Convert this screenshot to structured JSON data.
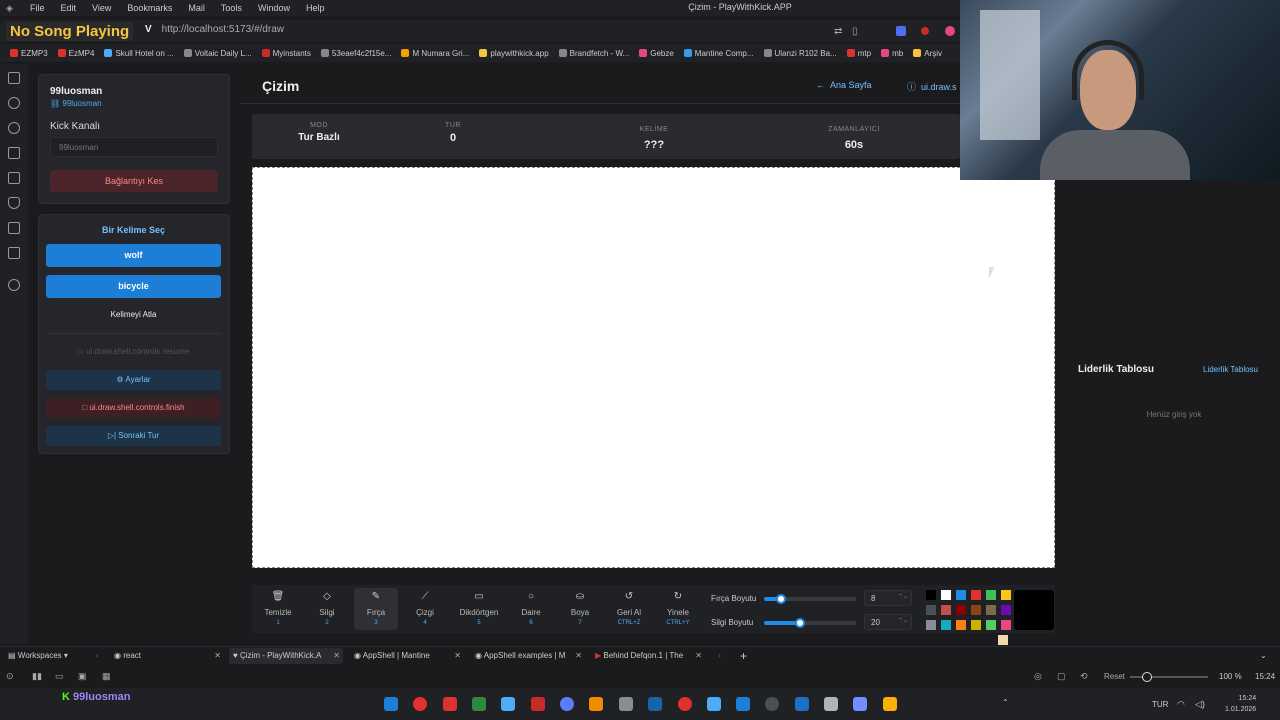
{
  "menu": {
    "items": [
      "File",
      "Edit",
      "View",
      "Bookmarks",
      "Mail",
      "Tools",
      "Window",
      "Help"
    ],
    "window_title": "Çizim - PlayWithKick.APP"
  },
  "overlay": {
    "now_playing": "No Song Playing"
  },
  "browser": {
    "url": "http://localhost:5173/#/draw",
    "url_prefix": "V"
  },
  "bookmarks": [
    {
      "label": "EZMP3",
      "color": "#e03131"
    },
    {
      "label": "EzMP4",
      "color": "#e03131"
    },
    {
      "label": "Skull Hotel on ...",
      "color": "#4dabf7"
    },
    {
      "label": "Voltaic Daily L...",
      "color": "#888888"
    },
    {
      "label": "Myinstants",
      "color": "#c92a2a"
    },
    {
      "label": "53eaef4c2f15e...",
      "color": "#888888"
    },
    {
      "label": "M Numara Gri...",
      "color": "#f59f00"
    },
    {
      "label": "playwithkick.app",
      "color": "#f5c542"
    },
    {
      "label": "Brandfetch - W...",
      "color": "#888888"
    },
    {
      "label": "Gebze",
      "color": "#e64980"
    },
    {
      "label": "Mantine Comp...",
      "color": "#339af0"
    },
    {
      "label": "Ulanzi R102 Ba...",
      "color": "#888888"
    },
    {
      "label": "mtp",
      "color": "#e03131"
    },
    {
      "label": "mb",
      "color": "#e64980"
    },
    {
      "label": "Arşiv",
      "color": "#f5c542"
    }
  ],
  "sidebar": {
    "user_name": "99luosman",
    "user_handle": "99luosman",
    "kick_label": "Kick Kanalı",
    "kick_placeholder": "99luosman",
    "disconnect": "Bağlantıyı Kes",
    "word_title": "Bir Kelime Seç",
    "words": [
      "wolf",
      "bicycle"
    ],
    "skip": "Kelimeyi Atla",
    "resume": "ui.draw.shell.controls.resume",
    "settings": "Ayarlar",
    "finish": "ui.draw.shell.controls.finish",
    "next_round": "Sonraki Tur"
  },
  "header": {
    "title": "Çizim",
    "home": "Ana Sayfa",
    "brand": "ui.draw.s"
  },
  "stats": [
    {
      "label": "MOD",
      "value": "Tur Bazlı"
    },
    {
      "label": "TUR",
      "value": "0"
    },
    {
      "label": "KELİME",
      "value": "???"
    },
    {
      "label": "ZAMANLAYICI",
      "value": "60s"
    }
  ],
  "leaderboard": {
    "title": "Liderlik Tablosu",
    "link": "Liderlik Tablosu",
    "empty": "Henüz giriş yok"
  },
  "tools": [
    {
      "icon": "🗑",
      "name": "Temizle",
      "shortcut": "1"
    },
    {
      "icon": "◇",
      "name": "Silgi",
      "shortcut": "2"
    },
    {
      "icon": "✎",
      "name": "Fırça",
      "shortcut": "3"
    },
    {
      "icon": "⟋",
      "name": "Çizgi",
      "shortcut": "4"
    },
    {
      "icon": "▭",
      "name": "Dikdörtgen",
      "shortcut": "5"
    },
    {
      "icon": "○",
      "name": "Daire",
      "shortcut": "6"
    },
    {
      "icon": "⛀",
      "name": "Boya",
      "shortcut": "7"
    },
    {
      "icon": "↺",
      "name": "Geri Al",
      "shortcut": "CTRL+Z"
    },
    {
      "icon": "↻",
      "name": "Yinele",
      "shortcut": "CTRL+Y"
    }
  ],
  "brush": {
    "label": "Fırça Boyutu",
    "value": "8",
    "fraction": 0.18
  },
  "eraser": {
    "label": "Silgi Boyutu",
    "value": "20",
    "fraction": 0.39
  },
  "palette": [
    "#000000",
    "#ffffff",
    "#228be6",
    "#e03131",
    "#40c057",
    "#fcc419",
    "#495057",
    "#c0504d",
    "#8b0000",
    "#8b4513",
    "#7e6b4f",
    "#6a0dad",
    "#868e96",
    "#15aabf",
    "#fd7e14",
    "#c9b200",
    "#51cf66",
    "#e64980",
    "#f4d9b0"
  ],
  "current_color": "#000000",
  "tabs": {
    "workspaces": "Workspaces",
    "items": [
      "react",
      "Çizim - PlayWithKick.A",
      "AppShell | Mantine",
      "AppShell examples | M",
      "Behind Defqon.1 | The"
    ]
  },
  "status": {
    "reset": "Reset",
    "zoom": "100 %",
    "time": "15:24"
  },
  "taskbar": {
    "kick_user": "99luosman",
    "lang": "TUR",
    "clock_time": "15:24",
    "clock_date": "1.01.2026"
  }
}
